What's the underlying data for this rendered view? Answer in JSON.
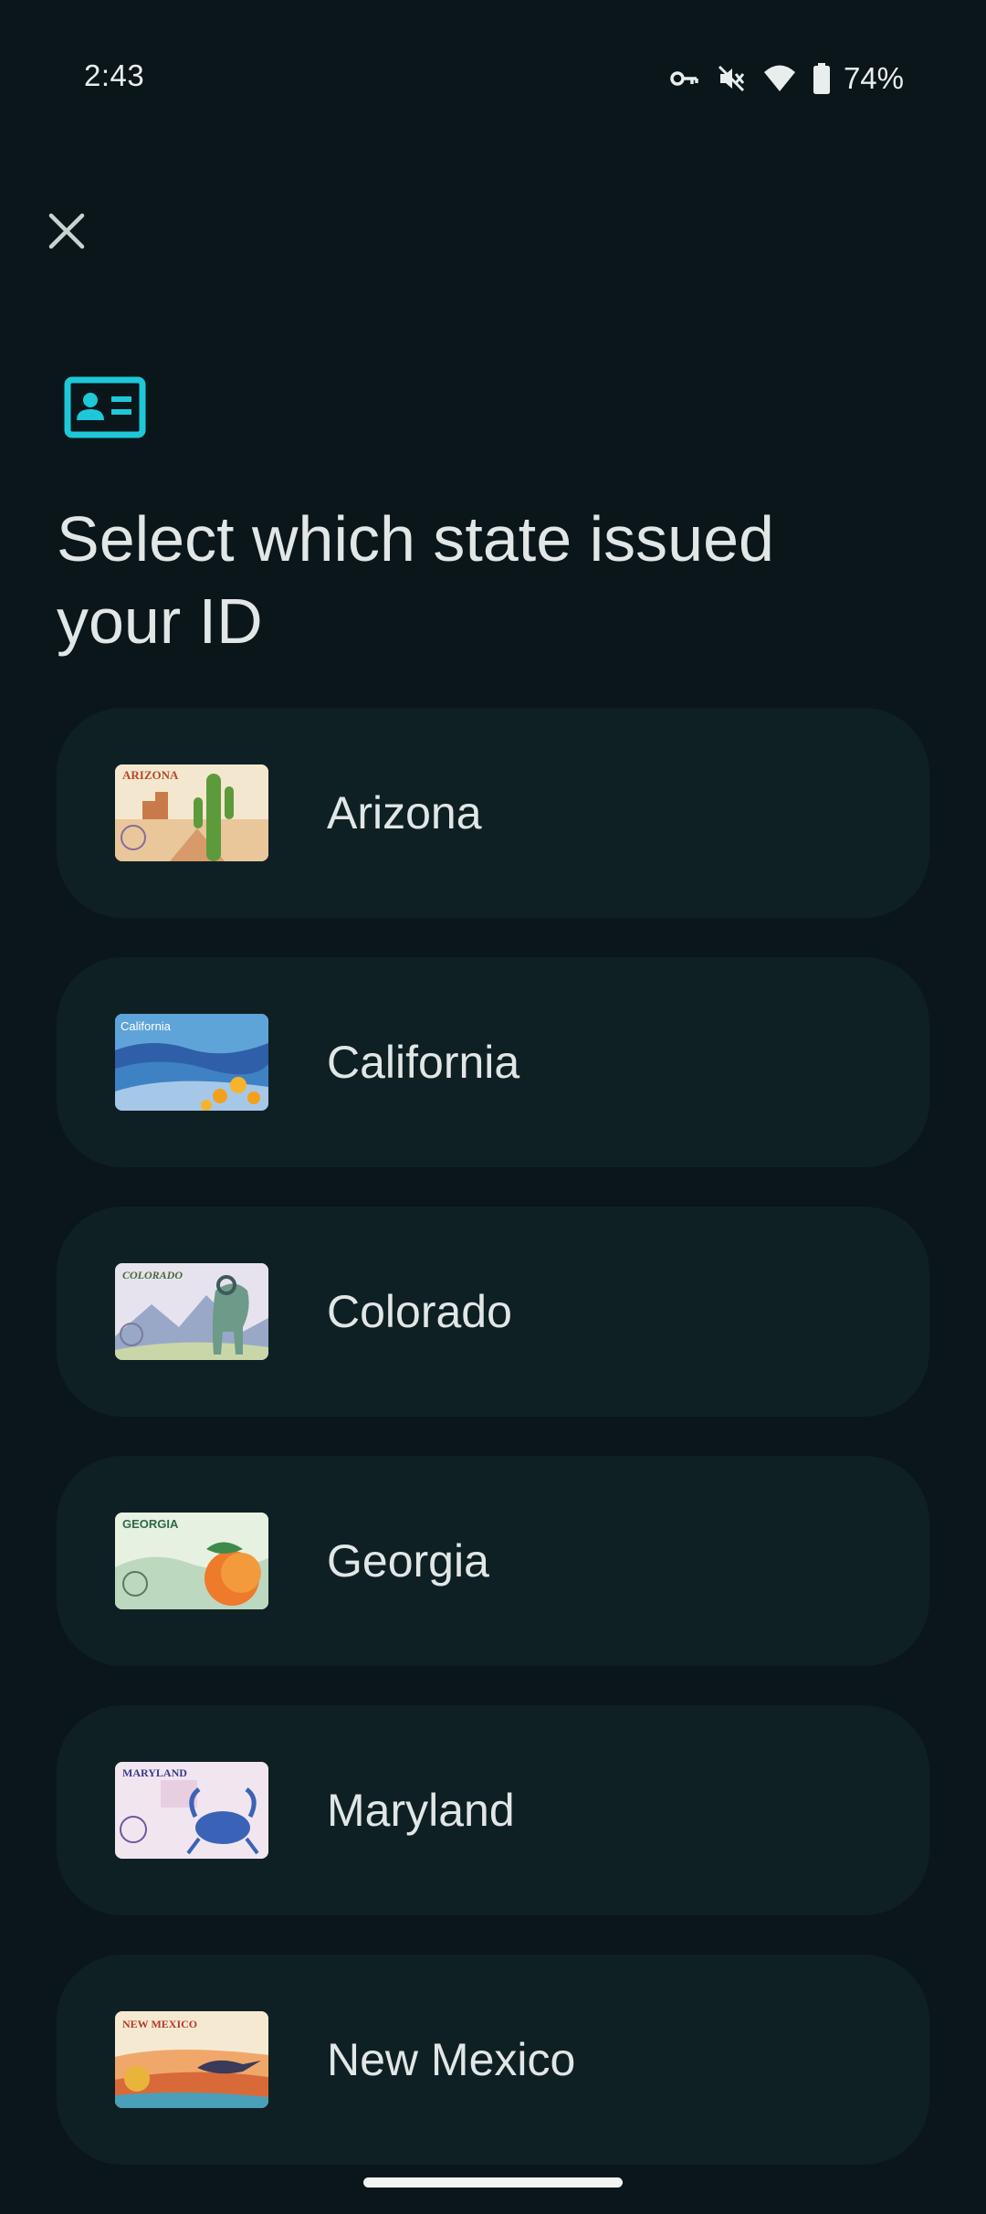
{
  "status_bar": {
    "time": "2:43",
    "battery_percent": "74%",
    "icons": [
      "vpn-key-icon",
      "vibrate-off-icon",
      "wifi-icon",
      "battery-icon"
    ]
  },
  "header": {
    "close_icon": "close-icon",
    "id_card_icon": "id-card-icon",
    "title": "Select which state issued your ID"
  },
  "states": [
    {
      "name": "Arizona",
      "card_text": "ARIZONA"
    },
    {
      "name": "California",
      "card_text": "California"
    },
    {
      "name": "Colorado",
      "card_text": "COLORADO"
    },
    {
      "name": "Georgia",
      "card_text": "GEORGIA"
    },
    {
      "name": "Maryland",
      "card_text": "MARYLAND"
    },
    {
      "name": "New Mexico",
      "card_text": "NEW MEXICO"
    }
  ],
  "colors": {
    "background": "#0b161a",
    "card": "#0f2024",
    "accent": "#1ec8d8",
    "text": "#e1e6e6"
  }
}
